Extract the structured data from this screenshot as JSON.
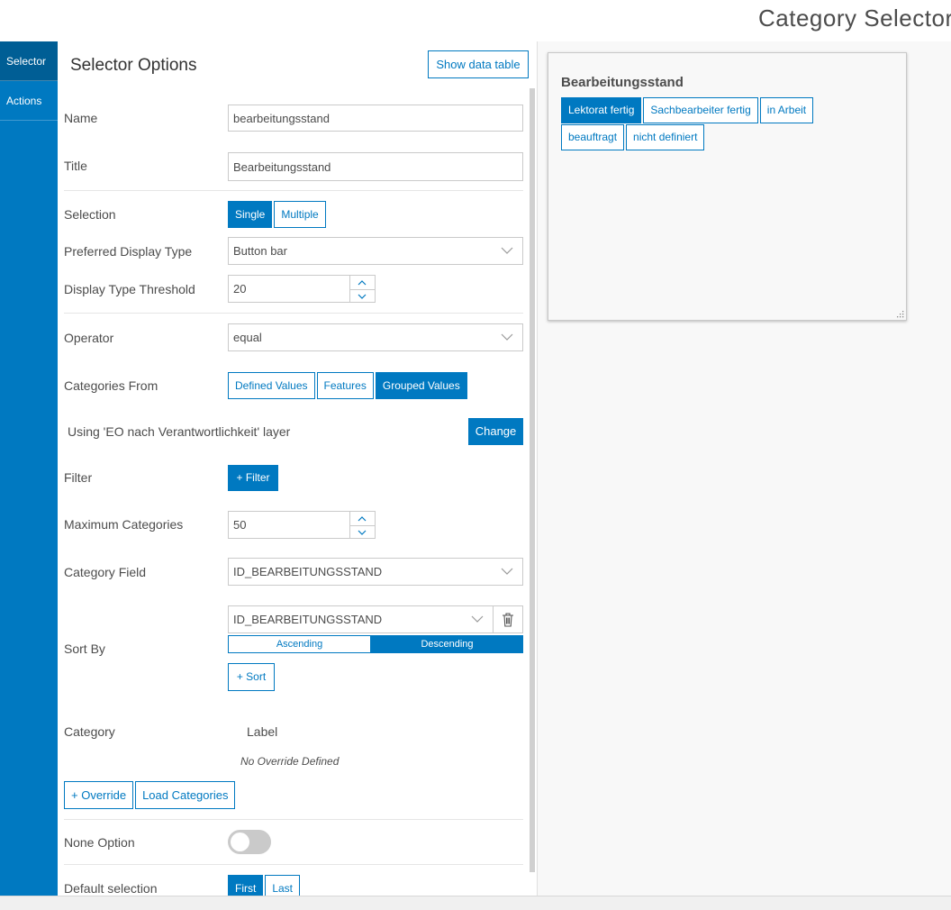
{
  "app": {
    "title": "Category Selector"
  },
  "sidebar": {
    "items": [
      {
        "label": "Selector"
      },
      {
        "label": "Actions"
      }
    ]
  },
  "panel": {
    "title": "Selector Options",
    "show_table_label": "Show data table",
    "name": {
      "label": "Name",
      "value": "bearbeitungsstand"
    },
    "title_field": {
      "label": "Title",
      "value": "Bearbeitungsstand"
    },
    "selection": {
      "label": "Selection",
      "options": [
        "Single",
        "Multiple"
      ],
      "selected": "Single"
    },
    "display_type": {
      "label": "Preferred Display Type",
      "value": "Button bar"
    },
    "threshold": {
      "label": "Display Type Threshold",
      "value": "20"
    },
    "operator": {
      "label": "Operator",
      "value": "equal"
    },
    "categories_from": {
      "label": "Categories From",
      "options": [
        "Defined Values",
        "Features",
        "Grouped Values"
      ],
      "selected": "Grouped Values"
    },
    "layer": {
      "text": "Using 'EO nach Verantwortlichkeit' layer",
      "change_label": "Change"
    },
    "filter": {
      "label": "Filter",
      "button": "+ Filter"
    },
    "max_categories": {
      "label": "Maximum Categories",
      "value": "50"
    },
    "category_field": {
      "label": "Category Field",
      "value": "ID_BEARBEITUNGSSTAND"
    },
    "sort_by": {
      "label": "Sort By",
      "field": "ID_BEARBEITUNGSSTAND",
      "ascending": "Ascending",
      "descending": "Descending",
      "selected": "Descending",
      "add_sort": "+ Sort"
    },
    "override": {
      "category_header": "Category",
      "label_header": "Label",
      "empty_text": "No Override Defined",
      "add_override": "+ Override",
      "load_categories": "Load Categories"
    },
    "none_option": {
      "label": "None Option",
      "enabled": false
    },
    "default_selection": {
      "label": "Default selection",
      "options": [
        "First",
        "Last"
      ],
      "selected": "First"
    }
  },
  "preview": {
    "title": "Bearbeitungsstand",
    "categories": [
      "Lektorat fertig",
      "Sachbearbeiter fertig",
      "in Arbeit",
      "beauftragt",
      "nicht definiert"
    ],
    "selected": "Lektorat fertig"
  },
  "colors": {
    "accent": "#0079c1",
    "accent_dark": "#005e95",
    "text": "#4c4c4c",
    "border": "#cacaca"
  },
  "icons": {
    "dropdown": "chevron-down-icon",
    "trash": "trash-icon",
    "step_up": "chevron-up-icon",
    "step_down": "chevron-down-icon",
    "resize": "resize-handle-icon"
  }
}
